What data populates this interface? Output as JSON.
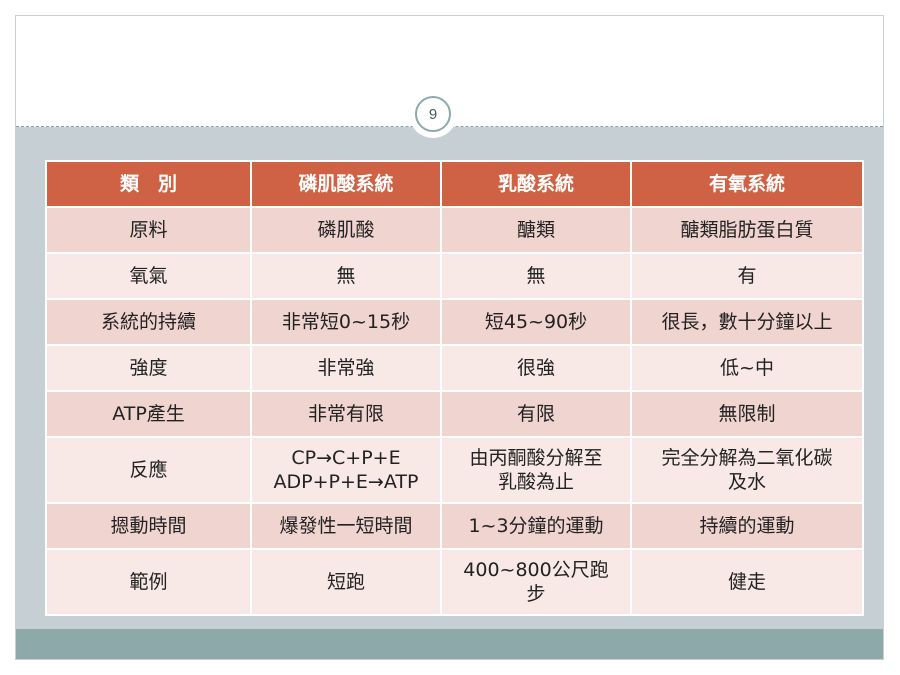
{
  "slide": {
    "page_number": "9"
  },
  "table": {
    "headers": [
      "類　別",
      "磷肌酸系統",
      "乳酸系統",
      "有氧系統"
    ],
    "rows": [
      {
        "cells": [
          [
            "原料"
          ],
          [
            "磷肌酸"
          ],
          [
            "醣類"
          ],
          [
            "醣類脂肪蛋白質"
          ]
        ]
      },
      {
        "cells": [
          [
            "氧氣"
          ],
          [
            "無"
          ],
          [
            "無"
          ],
          [
            "有"
          ]
        ]
      },
      {
        "cells": [
          [
            "系統的持續"
          ],
          [
            "非常短0~15秒"
          ],
          [
            "短45~90秒"
          ],
          [
            "很長，數十分鐘以上"
          ]
        ]
      },
      {
        "cells": [
          [
            "強度"
          ],
          [
            "非常強"
          ],
          [
            "很強"
          ],
          [
            "低~中"
          ]
        ]
      },
      {
        "cells": [
          [
            "ATP產生"
          ],
          [
            "非常有限"
          ],
          [
            "有限"
          ],
          [
            "無限制"
          ]
        ]
      },
      {
        "cells": [
          [
            "反應"
          ],
          [
            "CP→C+P+E",
            "ADP+P+E→ATP"
          ],
          [
            "由丙酮酸分解至",
            "乳酸為止"
          ],
          [
            "完全分解為二氧化碳",
            "及水"
          ]
        ]
      },
      {
        "cells": [
          [
            "摁動時間"
          ],
          [
            "爆發性一短時間"
          ],
          [
            "1~3分鐘的運動"
          ],
          [
            "持續的運動"
          ]
        ]
      },
      {
        "cells": [
          [
            "範例"
          ],
          [
            "短跑"
          ],
          [
            "400~800公尺跑",
            "步"
          ],
          [
            "健走"
          ]
        ]
      }
    ]
  },
  "colors": {
    "header_bg": "#cf6244",
    "row_odd_bg": "#f0d4d0",
    "row_even_bg": "#f8e9e7",
    "content_bg": "#c5cfd4",
    "footer_bg": "#8da9aa"
  }
}
